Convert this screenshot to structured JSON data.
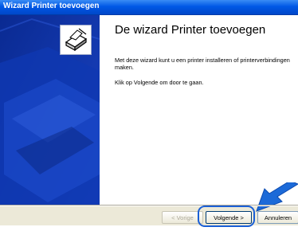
{
  "window": {
    "title": "Wizard Printer toevoegen"
  },
  "main": {
    "heading": "De wizard Printer toevoegen",
    "paragraph1": "Met deze wizard kunt u een printer installeren of printerverbindingen maken.",
    "paragraph2": "Klik op Volgende om door te gaan."
  },
  "buttons": {
    "back": "< Vorige",
    "next": "Volgende >",
    "cancel": "Annuleren"
  },
  "icons": {
    "wizard": "printer-wizard-icon",
    "callout": "pointer-arrow-icon"
  },
  "colors": {
    "titlebar": "#0058e6",
    "sidepanel": "#0b2d9b",
    "highlight": "#1a5fd6",
    "dialog_bg": "#ece9d8"
  }
}
